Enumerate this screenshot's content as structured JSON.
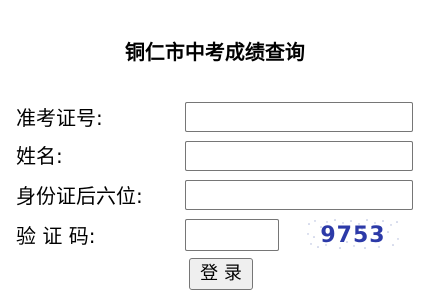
{
  "page": {
    "title": "铜仁市中考成绩查询"
  },
  "form": {
    "exam_number_label": "准考证号:",
    "exam_number_value": "",
    "name_label": "姓名:",
    "name_value": "",
    "id_last6_label": "身份证后六位:",
    "id_last6_value": "",
    "captcha_label": "验 证 码:",
    "captcha_value": "",
    "captcha_image_text": "9753",
    "submit_label": "登 录"
  },
  "colors": {
    "captcha_text": "#2c3aa8",
    "captcha_noise": "#8a97c9",
    "button_bg": "#efefef",
    "border": "#767676"
  }
}
